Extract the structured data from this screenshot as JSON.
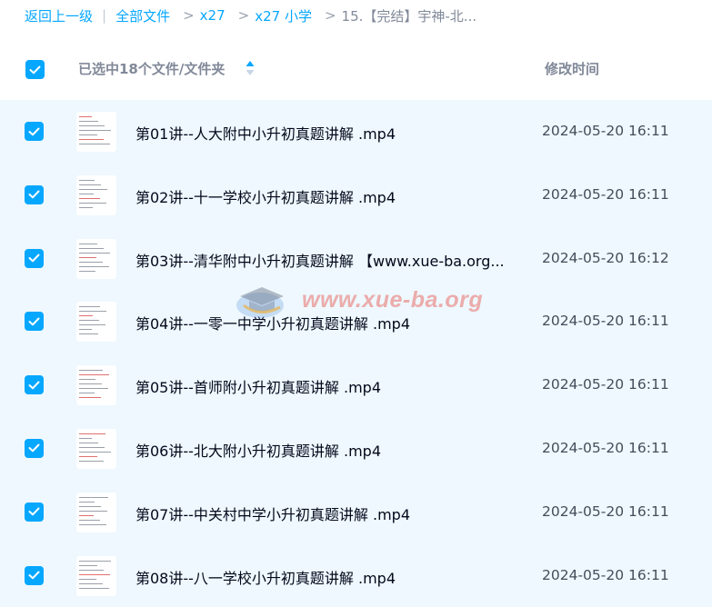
{
  "breadcrumb": {
    "back": "返回上一级",
    "separator": "|",
    "arrow": ">",
    "items": [
      "全部文件",
      "x27",
      "x27 小学"
    ],
    "current": "15.【完结】宇神-北..."
  },
  "header": {
    "selected_label": "已选中18个文件/文件夹",
    "time_label": "修改时间"
  },
  "files": [
    {
      "name": "第01讲--人大附中小升初真题讲解 .mp4",
      "time": "2024-05-20 16:11"
    },
    {
      "name": "第02讲--十一学校小升初真题讲解 .mp4",
      "time": "2024-05-20 16:11"
    },
    {
      "name": "第03讲--清华附中小升初真题讲解 【www.xue-ba.org...",
      "time": "2024-05-20 16:12"
    },
    {
      "name": "第04讲--一零一中学小升初真题讲解 .mp4",
      "time": "2024-05-20 16:11"
    },
    {
      "name": "第05讲--首师附小升初真题讲解 .mp4",
      "time": "2024-05-20 16:11"
    },
    {
      "name": "第06讲--北大附小升初真题讲解 .mp4",
      "time": "2024-05-20 16:11"
    },
    {
      "name": "第07讲--中关村中学小升初真题讲解 .mp4",
      "time": "2024-05-20 16:11"
    },
    {
      "name": "第08讲--八一学校小升初真题讲解 .mp4",
      "time": "2024-05-20 16:11"
    }
  ],
  "watermark": {
    "text": "www.xue-ba.org"
  },
  "colors": {
    "accent": "#06a7ff",
    "row_bg": "#eef8fe",
    "muted": "#818999"
  }
}
